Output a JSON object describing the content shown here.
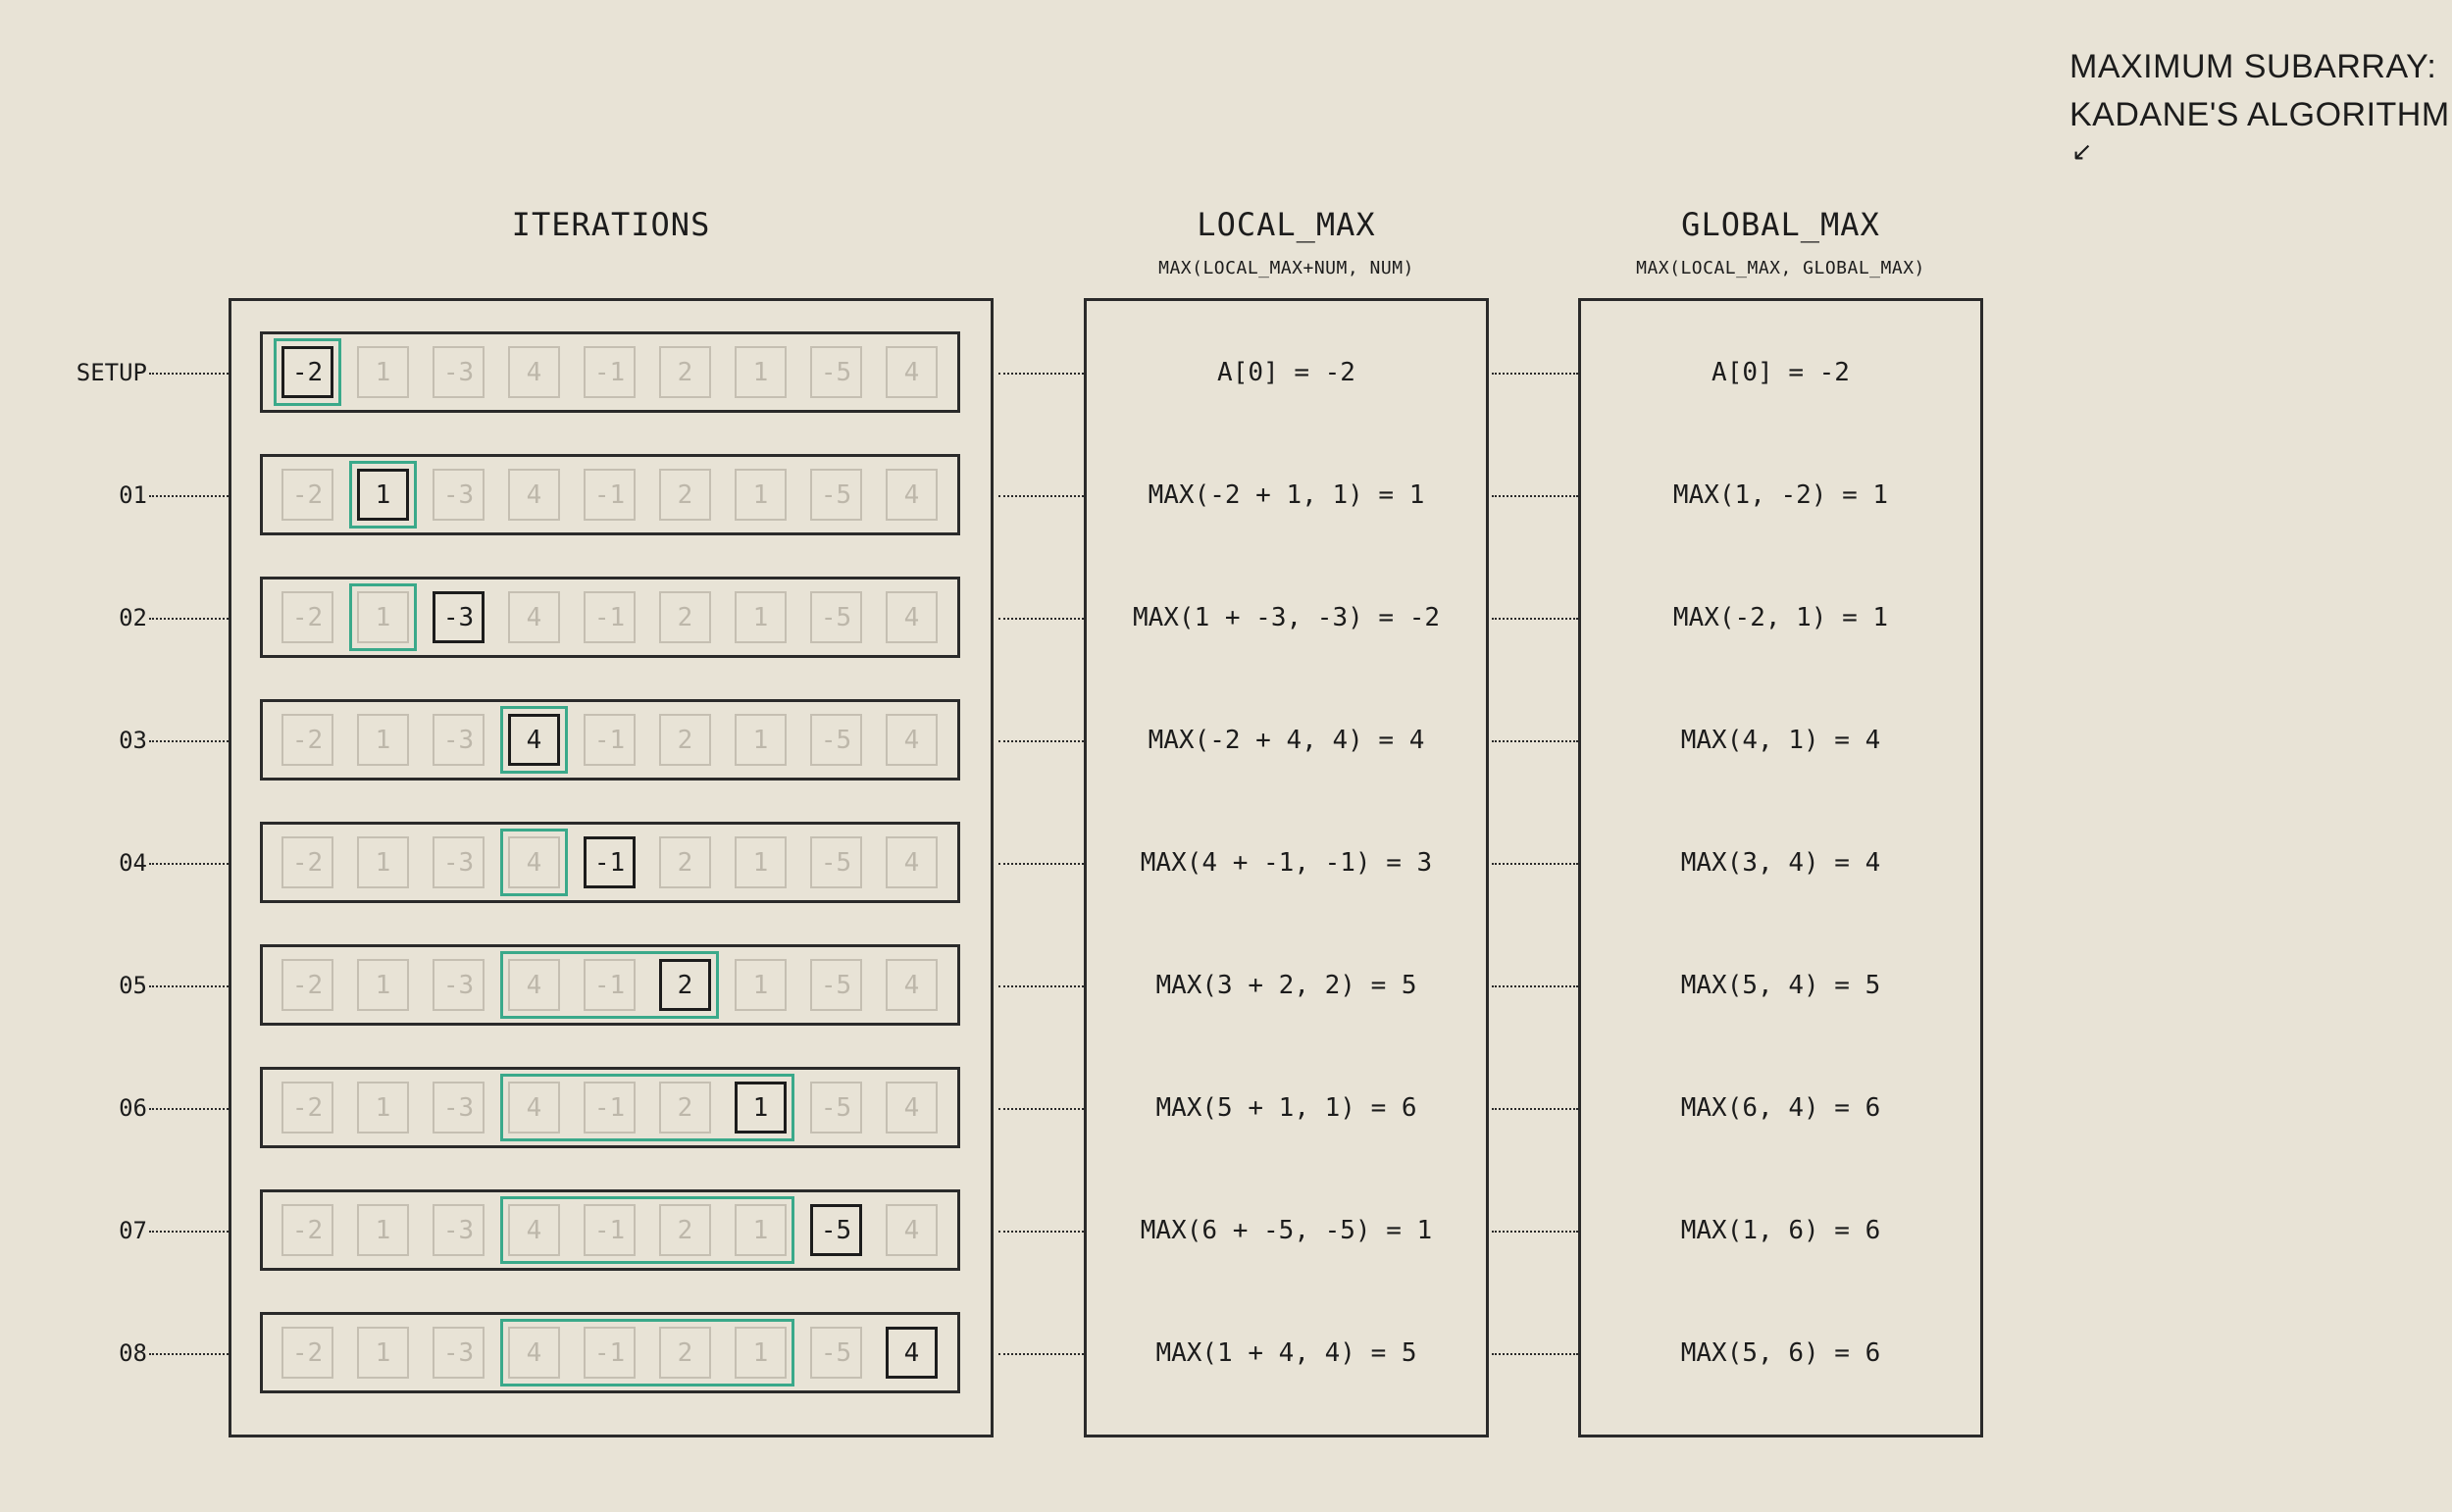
{
  "title": {
    "line1": "MAXIMUM SUBARRAY:",
    "line2": "KADANE'S ALGORITHM",
    "arrow": "↙"
  },
  "columns": {
    "iterations": {
      "heading": "ITERATIONS"
    },
    "local_max": {
      "heading": "LOCAL_MAX",
      "sub": "MAX(LOCAL_MAX+NUM, NUM)"
    },
    "global_max": {
      "heading": "GLOBAL_MAX",
      "sub": "MAX(LOCAL_MAX, GLOBAL_MAX)"
    }
  },
  "array": [
    "-2",
    "1",
    "-3",
    "4",
    "-1",
    "2",
    "1",
    "-5",
    "4"
  ],
  "colors": {
    "background": "#e8e3d6",
    "highlight": "#3aa98a",
    "ink": "#1c1c1c",
    "inactive": "#c5bfb2"
  },
  "rows": [
    {
      "label": "SETUP",
      "current": 0,
      "highlight": [
        0,
        0
      ],
      "local": "A[0] = -2",
      "global": "A[0] = -2"
    },
    {
      "label": "01",
      "current": 1,
      "highlight": [
        1,
        1
      ],
      "local": "MAX(-2 + 1, 1) = 1",
      "global": "MAX(1, -2) = 1"
    },
    {
      "label": "02",
      "current": 2,
      "highlight": [
        1,
        1
      ],
      "local": "MAX(1 + -3, -3) = -2",
      "global": "MAX(-2, 1) = 1"
    },
    {
      "label": "03",
      "current": 3,
      "highlight": [
        3,
        3
      ],
      "local": "MAX(-2 + 4, 4) = 4",
      "global": "MAX(4, 1) = 4"
    },
    {
      "label": "04",
      "current": 4,
      "highlight": [
        3,
        3
      ],
      "local": "MAX(4 + -1, -1) = 3",
      "global": "MAX(3, 4) = 4"
    },
    {
      "label": "05",
      "current": 5,
      "highlight": [
        3,
        5
      ],
      "local": "MAX(3 + 2, 2) = 5",
      "global": "MAX(5, 4) = 5"
    },
    {
      "label": "06",
      "current": 6,
      "highlight": [
        3,
        6
      ],
      "local": "MAX(5 + 1, 1) = 6",
      "global": "MAX(6, 4) = 6"
    },
    {
      "label": "07",
      "current": 7,
      "highlight": [
        3,
        6
      ],
      "local": "MAX(6 + -5, -5) = 1",
      "global": "MAX(1, 6) = 6"
    },
    {
      "label": "08",
      "current": 8,
      "highlight": [
        3,
        6
      ],
      "local": "MAX(1 + 4, 4) = 5",
      "global": "MAX(5, 6) = 6"
    }
  ]
}
